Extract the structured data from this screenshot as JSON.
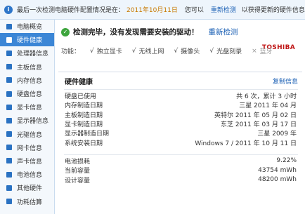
{
  "topbar": {
    "info_icon": "i",
    "text": "最后一次检测电脑硬件配置情况是在：",
    "date": "2011年10月11日",
    "you_can": "您可以",
    "redetect": "重新检测",
    "after": "以获得更新的硬件信息"
  },
  "sidebar": {
    "items": [
      {
        "label": "电脑概览"
      },
      {
        "label": "硬件健康"
      },
      {
        "label": "处理器信息"
      },
      {
        "label": "主板信息"
      },
      {
        "label": "内存信息"
      },
      {
        "label": "硬盘信息"
      },
      {
        "label": "显卡信息"
      },
      {
        "label": "显示器信息"
      },
      {
        "label": "光驱信息"
      },
      {
        "label": "网卡信息"
      },
      {
        "label": "声卡信息"
      },
      {
        "label": "电池信息"
      },
      {
        "label": "其他硬件"
      },
      {
        "label": "功耗估算"
      }
    ],
    "active_index": 1
  },
  "main": {
    "check_icon": "✓",
    "status": "检测完毕，没有发现需要安装的驱动！",
    "redetect": "重新检测",
    "brand": "TOSHIBA",
    "features_label": "功能：",
    "features": [
      {
        "tick": "√",
        "label": "独立显卡",
        "enabled": true
      },
      {
        "tick": "√",
        "label": "无线上网",
        "enabled": true
      },
      {
        "tick": "√",
        "label": "摄像头",
        "enabled": true
      },
      {
        "tick": "√",
        "label": "光盘刻录",
        "enabled": true
      },
      {
        "tick": "×",
        "label": "蓝牙",
        "enabled": false
      }
    ],
    "panel": {
      "title": "硬件健康",
      "copy": "复制信息",
      "group1": [
        {
          "label": "硬盘已使用",
          "value": "共 6 次，累计 3 小时"
        },
        {
          "label": "内存制造日期",
          "value": "三星 2011 年 04 月"
        },
        {
          "label": "主板制造日期",
          "value": "英特尔 2011 年 05 月 02 日"
        },
        {
          "label": "显卡制造日期",
          "value": "东芝 2011 年 03 月 17 日"
        },
        {
          "label": "显示器制造日期",
          "value": "三星 2009 年"
        },
        {
          "label": "系统安装日期",
          "value": "Windows 7 / 2011 年 10 月 11 日"
        }
      ],
      "group2": [
        {
          "label": "电池损耗",
          "value": "9.22%"
        },
        {
          "label": "当前容量",
          "value": "43754 mWh"
        },
        {
          "label": "设计容量",
          "value": "48200 mWh"
        }
      ]
    }
  }
}
